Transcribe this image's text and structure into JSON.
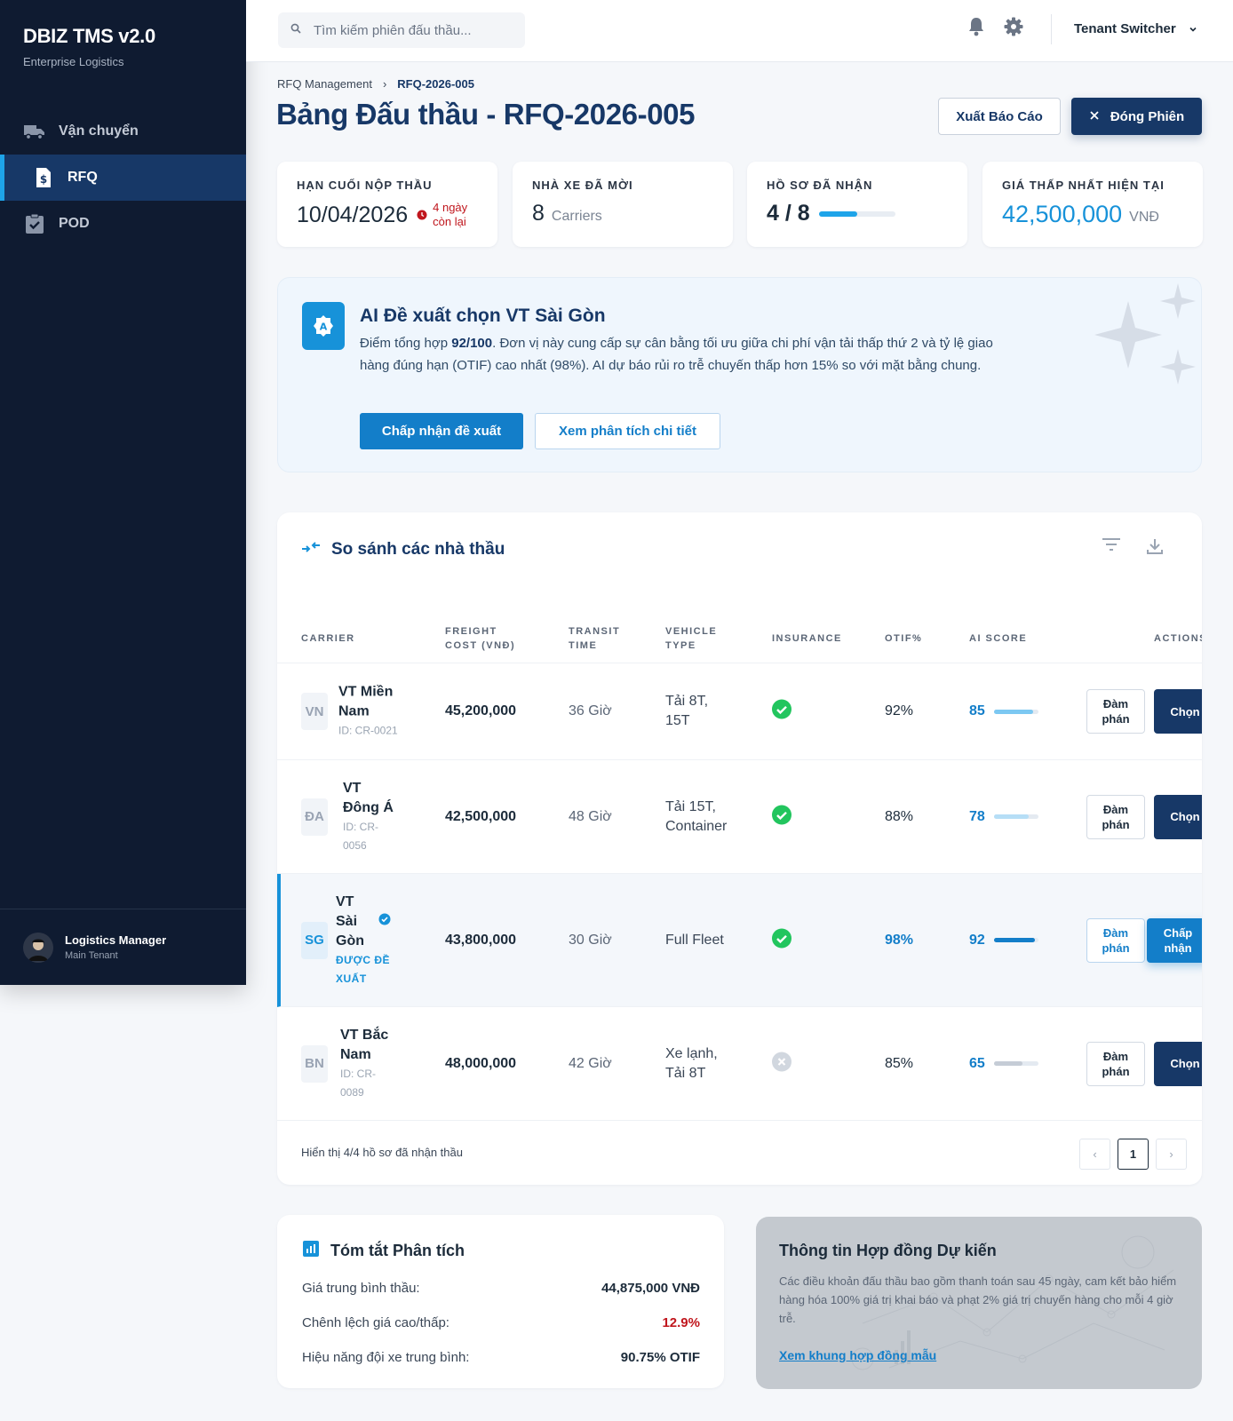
{
  "sidebar": {
    "brand_title": "DBIZ TMS v2.0",
    "brand_sub": "Enterprise Logistics",
    "items": [
      {
        "label": "Vận chuyển",
        "icon": "truck-icon",
        "active": false
      },
      {
        "label": "RFQ",
        "icon": "invoice-icon",
        "active": true
      },
      {
        "label": "POD",
        "icon": "clipboard-check-icon",
        "active": false
      }
    ],
    "user": {
      "name": "Logistics Manager",
      "tenant": "Main Tenant"
    }
  },
  "topbar": {
    "search_placeholder": "Tìm kiếm phiên đấu thầu...",
    "tenant_switcher": "Tenant Switcher"
  },
  "breadcrumb": {
    "parent": "RFQ Management",
    "separator": "›",
    "current": "RFQ-2026-005"
  },
  "header": {
    "title": "Bảng Đấu thầu - RFQ-2026-005",
    "export_label": "Xuất Báo Cáo",
    "close_label": "Đóng Phiên"
  },
  "stats": {
    "deadline": {
      "label": "HẠN CUỐI NỘP THẦU",
      "value": "10/04/2026",
      "note_line1": "4 ngày",
      "note_line2": "còn lại"
    },
    "invited": {
      "label": "NHÀ XE ĐÃ MỜI",
      "value": "8",
      "unit": "Carriers"
    },
    "received": {
      "label": "HỒ SƠ ĐÃ NHẬN",
      "value": "4 / 8",
      "progress": 0.5
    },
    "lowest": {
      "label": "GIÁ THẤP NHẤT HIỆN TẠI",
      "value": "42,500,000",
      "unit": "VNĐ"
    }
  },
  "ai": {
    "title": "AI Đề xuất chọn VT Sài Gòn",
    "desc_prefix": "Điểm tổng hợp ",
    "desc_score": "92/100",
    "desc_rest": ". Đơn vị này cung cấp sự cân bằng tối ưu giữa chi phí vận tải thấp thứ 2 và tỷ lệ giao hàng đúng hạn (OTIF) cao nhất (98%). AI dự báo rủi ro trễ chuyến thấp hơn 15% so với mặt bằng chung.",
    "accept_label": "Chấp nhận đề xuất",
    "analysis_label": "Xem phân tích chi tiết"
  },
  "table": {
    "title": "So sánh các nhà thầu",
    "headers": {
      "carrier": "CARRIER",
      "freight_1": "FREIGHT",
      "freight_2": "COST (VNĐ)",
      "transit_1": "TRANSIT",
      "transit_2": "TIME",
      "vehicle_1": "VEHICLE",
      "vehicle_2": "TYPE",
      "insurance": "INSURANCE",
      "otif": "OTIF%",
      "ai_score": "AI SCORE",
      "actions": "ACTIONS"
    },
    "rows": [
      {
        "initials": "VN",
        "name_l1": "VT Miền",
        "name_l2": "Nam",
        "name_l3": "",
        "sub_l1": "ID: CR-0021",
        "sub_l2": "",
        "cost": "45,200,000",
        "transit": "36 Giờ",
        "vehicle_l1": "Tải 8T,",
        "vehicle_l2": "15T",
        "insured": true,
        "otif": "92%",
        "score": "85",
        "score_value": 85,
        "negotiate_l1": "Đàm",
        "negotiate_l2": "phán",
        "choose_l1": "Chọn",
        "choose_l2": ""
      },
      {
        "initials": "ĐA",
        "name_l1": "VT",
        "name_l2": "Đông Á",
        "name_l3": "",
        "sub_l1": "ID: CR-",
        "sub_l2": "0056",
        "cost": "42,500,000",
        "transit": "48 Giờ",
        "vehicle_l1": "Tải 15T,",
        "vehicle_l2": "Container",
        "insured": true,
        "otif": "88%",
        "score": "78",
        "score_value": 78,
        "negotiate_l1": "Đàm",
        "negotiate_l2": "phán",
        "choose_l1": "Chọn",
        "choose_l2": ""
      },
      {
        "initials": "SG",
        "name_l1": "VT",
        "name_l2": "Sài",
        "name_l3": "Gòn",
        "sub_l1": "ĐƯỢC ĐỀ",
        "sub_l2": "XUẤT",
        "cost": "43,800,000",
        "transit": "30 Giờ",
        "vehicle_l1": "Full Fleet",
        "vehicle_l2": "",
        "insured": true,
        "otif": "98%",
        "score": "92",
        "score_value": 92,
        "negotiate_l1": "Đàm",
        "negotiate_l2": "phán",
        "choose_l1": "Chấp",
        "choose_l2": "nhận",
        "recommended": true
      },
      {
        "initials": "BN",
        "name_l1": "VT Bắc",
        "name_l2": "Nam",
        "name_l3": "",
        "sub_l1": "ID: CR-",
        "sub_l2": "0089",
        "cost": "48,000,000",
        "transit": "42 Giờ",
        "vehicle_l1": "Xe lạnh,",
        "vehicle_l2": "Tải 8T",
        "insured": false,
        "otif": "85%",
        "score": "65",
        "score_value": 65,
        "negotiate_l1": "Đàm",
        "negotiate_l2": "phán",
        "choose_l1": "Chọn",
        "choose_l2": ""
      }
    ],
    "footer_text": "Hiển thị 4/4 hồ sơ đã nhận thầu",
    "page": "1",
    "prev": "‹",
    "next": "›"
  },
  "summary": {
    "title": "Tóm tắt Phân tích",
    "rows": [
      {
        "k": "Giá trung bình thầu:",
        "v": "44,875,000 VNĐ"
      },
      {
        "k": "Chênh lệch giá cao/thấp:",
        "v": "12.9%"
      },
      {
        "k": "Hiệu năng đội xe trung bình:",
        "v": "90.75% OTIF"
      }
    ]
  },
  "contract": {
    "title": "Thông tin Hợp đồng Dự kiến",
    "desc": "Các điều khoản đấu thầu bao gồm thanh toán sau 45 ngày, cam kết bảo hiểm hàng hóa 100% giá trị khai báo và phạt 2% giá trị chuyến hàng cho mỗi 4 giờ trễ.",
    "link": "Xem khung hợp đồng mẫu"
  },
  "colors": {
    "primary": "#173867",
    "accent": "#1792d9",
    "sidebar": "#0f1b31",
    "danger": "#c0161d",
    "success": "#22c55e"
  }
}
